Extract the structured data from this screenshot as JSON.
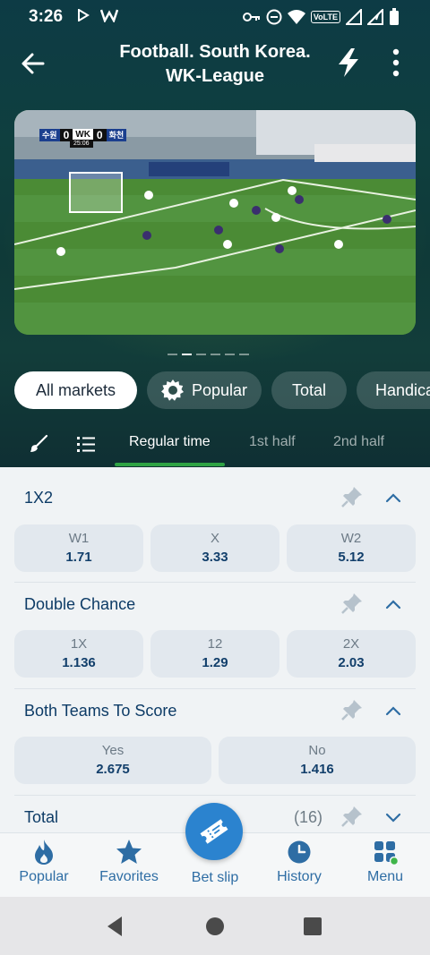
{
  "status_bar": {
    "time": "3:26",
    "network_badge": "VoLTE",
    "icons": [
      "play-icon",
      "w-app-icon",
      "key-icon",
      "dnd-icon",
      "wifi-icon",
      "signal-icon",
      "signal-icon-2",
      "battery-icon"
    ]
  },
  "header": {
    "title_line1": "Football. South Korea.",
    "title_line2": "WK-League",
    "back_icon": "arrow-left-icon",
    "action_icon": "lightning-icon",
    "menu_icon": "more-vertical-icon"
  },
  "video": {
    "home_team": "수원",
    "home_score": "0",
    "away_score": "0",
    "away_team": "화천",
    "broadcaster": "WK",
    "clock": "25:06",
    "pager_count": 6,
    "pager_active_index": 1
  },
  "market_chips": [
    {
      "label": "All markets",
      "active": true
    },
    {
      "label": "Popular",
      "active": false,
      "icon": "gear-badge-icon"
    },
    {
      "label": "Total",
      "active": false
    },
    {
      "label": "Handica",
      "active": false
    }
  ],
  "period_tabs": {
    "tools": [
      "brush-icon",
      "list-icon"
    ],
    "tabs": [
      {
        "label": "Regular time",
        "active": true
      },
      {
        "label": "1st half",
        "active": false
      },
      {
        "label": "2nd half",
        "active": false
      }
    ]
  },
  "markets": [
    {
      "title": "1X2",
      "expanded": true,
      "odds": [
        {
          "label": "W1",
          "value": "1.71"
        },
        {
          "label": "X",
          "value": "3.33"
        },
        {
          "label": "W2",
          "value": "5.12"
        }
      ]
    },
    {
      "title": "Double Chance",
      "expanded": true,
      "odds": [
        {
          "label": "1X",
          "value": "1.136"
        },
        {
          "label": "12",
          "value": "1.29"
        },
        {
          "label": "2X",
          "value": "2.03"
        }
      ]
    },
    {
      "title": "Both Teams To Score",
      "expanded": true,
      "odds": [
        {
          "label": "Yes",
          "value": "2.675"
        },
        {
          "label": "No",
          "value": "1.416"
        }
      ]
    },
    {
      "title": "Total",
      "count": "(16)",
      "expanded": false
    }
  ],
  "bottom_nav": {
    "popular": "Popular",
    "favorites": "Favorites",
    "bet_slip": "Bet slip",
    "history": "History",
    "menu": "Menu"
  },
  "colors": {
    "accent_green": "#2fa344",
    "primary_blue": "#2b83cf",
    "title_navy": "#0d3b66",
    "header_dark": "#0f3a38"
  }
}
